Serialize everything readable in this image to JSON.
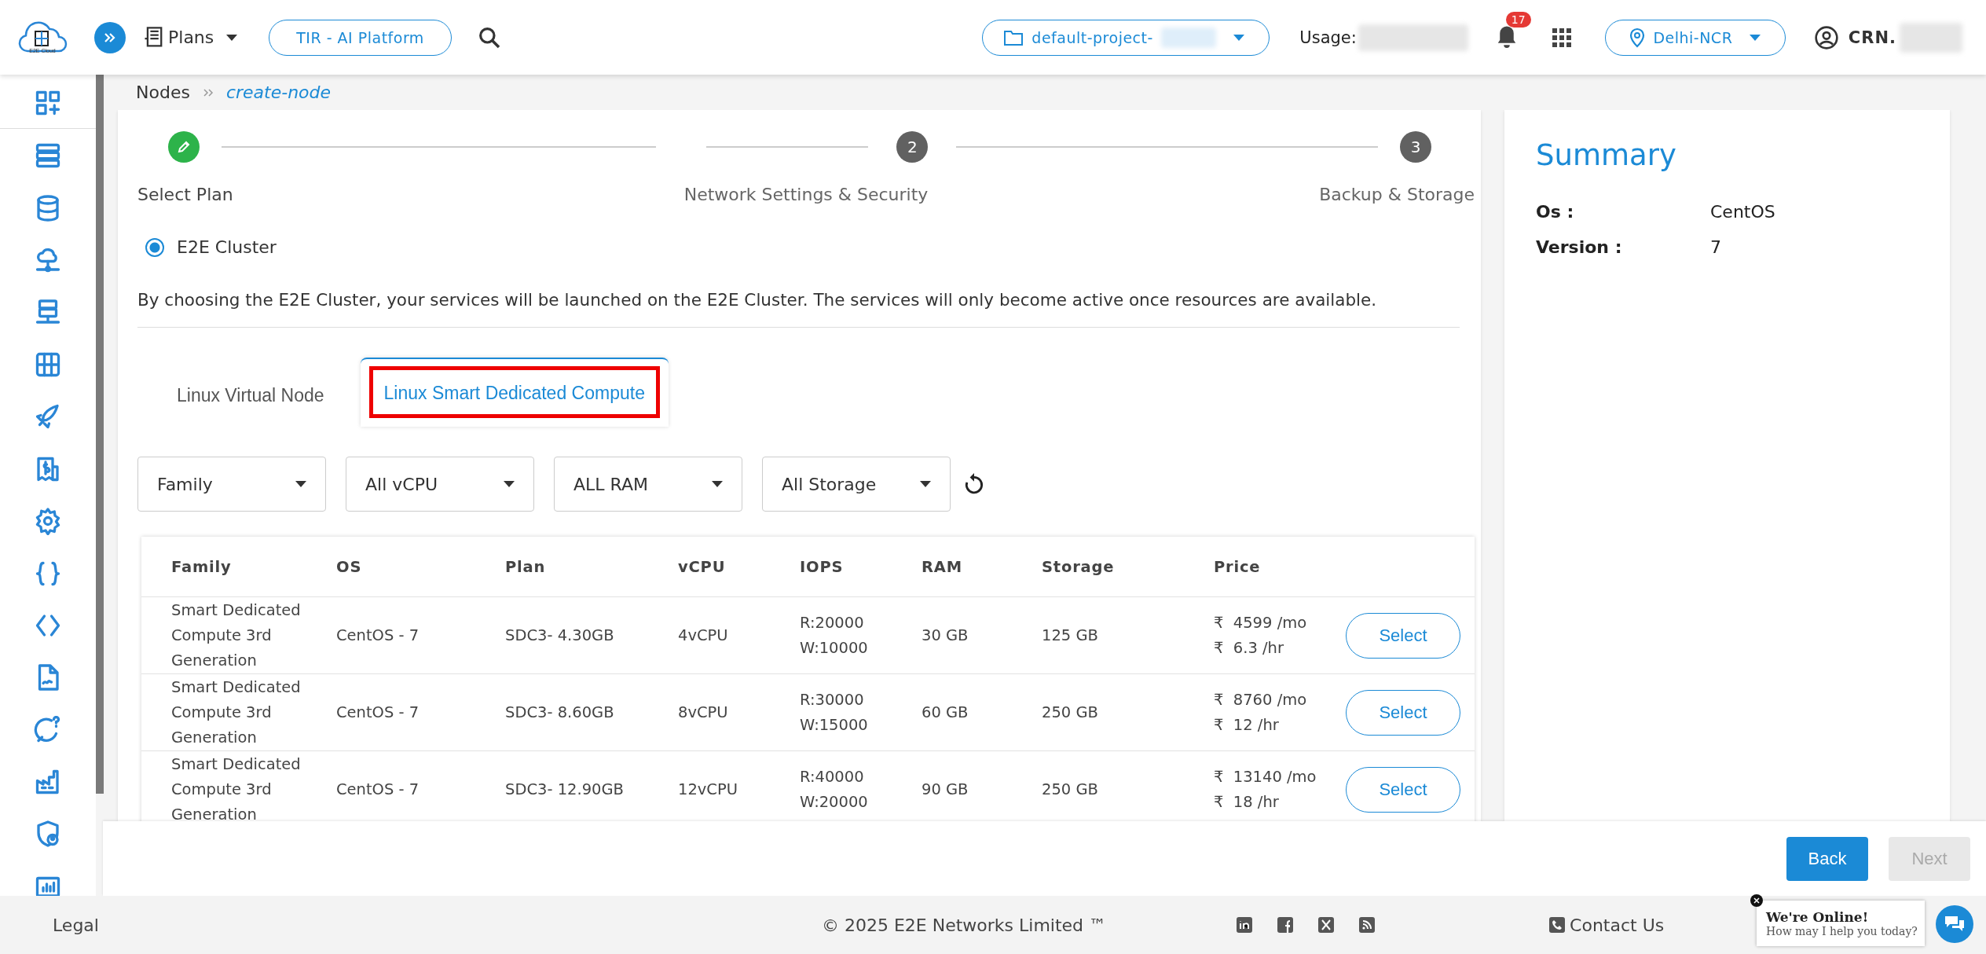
{
  "header": {
    "logo_caption": "E2E Cloud",
    "menu": "Plans",
    "platform_button": "TIR - AI Platform",
    "project": "default-project-",
    "usage_label": "Usage:",
    "notifications": "17",
    "region": "Delhi-NCR",
    "account": "CRN."
  },
  "breadcrumb": {
    "parent": "Nodes",
    "current": "create-node"
  },
  "steps": [
    {
      "label": "Select Plan",
      "completed": true
    },
    {
      "number": "2",
      "label": "Network Settings & Security",
      "completed": false
    },
    {
      "number": "3",
      "label": "Backup & Storage",
      "completed": false
    }
  ],
  "cluster_option": {
    "label": "E2E Cluster",
    "selected": true
  },
  "notice": "By choosing the E2E Cluster, your services will be launched on the E2E Cluster. The services will only become active once resources are available.",
  "tabs": [
    {
      "label": "Linux Virtual Node",
      "selected": false,
      "highlighted": false
    },
    {
      "label": "Linux Smart Dedicated Compute",
      "selected": true,
      "highlighted": true
    }
  ],
  "filters": [
    "Family",
    "All vCPU",
    "ALL RAM",
    "All Storage"
  ],
  "table": {
    "columns": [
      "Family",
      "OS",
      "Plan",
      "vCPU",
      "IOPS",
      "RAM",
      "Storage",
      "Price"
    ],
    "rows": [
      {
        "family": "Smart Dedicated Compute 3rd Generation",
        "os": "CentOS - 7",
        "plan": "SDC3- 4.30GB",
        "vcpu": "4vCPU",
        "iops": [
          "R:20000",
          "W:10000"
        ],
        "ram": "30 GB",
        "storage": "125 GB",
        "price": [
          "4599 /mo",
          "6.3 /hr"
        ],
        "currency": "₹",
        "action": "Select"
      },
      {
        "family": "Smart Dedicated Compute 3rd Generation",
        "os": "CentOS - 7",
        "plan": "SDC3- 8.60GB",
        "vcpu": "8vCPU",
        "iops": [
          "R:30000",
          "W:15000"
        ],
        "ram": "60 GB",
        "storage": "250 GB",
        "price": [
          "8760 /mo",
          "12 /hr"
        ],
        "currency": "₹",
        "action": "Select"
      },
      {
        "family": "Smart Dedicated Compute 3rd Generation",
        "os": "CentOS - 7",
        "plan": "SDC3- 12.90GB",
        "vcpu": "12vCPU",
        "iops": [
          "R:40000",
          "W:20000"
        ],
        "ram": "90 GB",
        "storage": "250 GB",
        "price": [
          "13140 /mo",
          "18 /hr"
        ],
        "currency": "₹",
        "action": "Select"
      }
    ]
  },
  "summary": {
    "title": "Summary",
    "fields": [
      {
        "label": "Os :",
        "value": "CentOS"
      },
      {
        "label": "Version :",
        "value": "7"
      }
    ]
  },
  "actions": [
    {
      "label": "Back",
      "disabled": false
    },
    {
      "label": "Next",
      "disabled": true
    }
  ],
  "footer": {
    "legal": "Legal",
    "copyright": "© 2025 E2E Networks Limited ™",
    "contact": "Contact Us"
  },
  "chat": {
    "title": "We're Online!",
    "subtitle": "How may I help you today?"
  }
}
